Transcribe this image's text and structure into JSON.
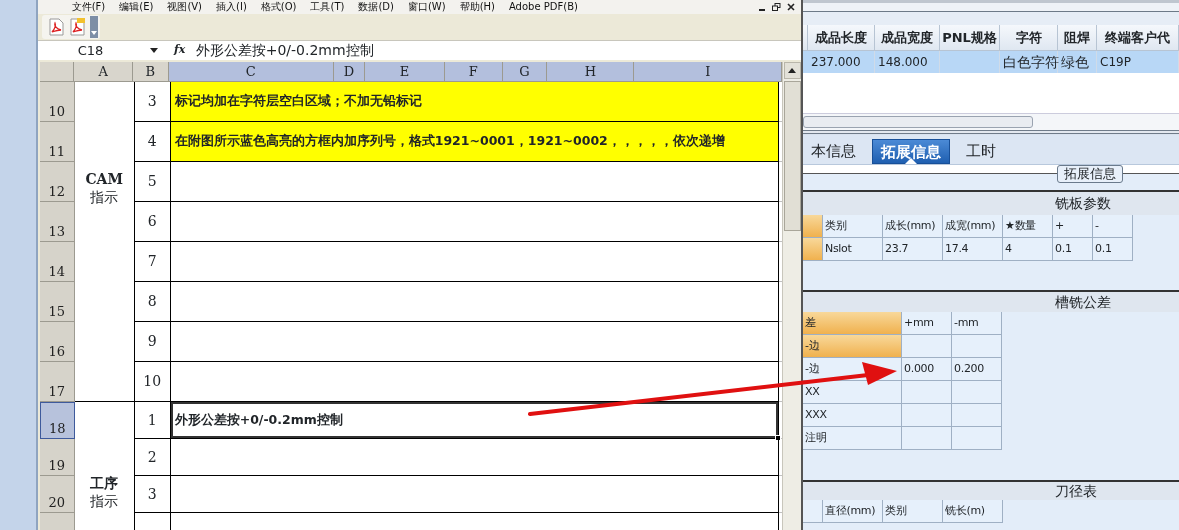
{
  "excel": {
    "menu": [
      "文件(F)",
      "编辑(E)",
      "视图(V)",
      "插入(I)",
      "格式(O)",
      "工具(T)",
      "数据(D)",
      "窗口(W)",
      "帮助(H)",
      "Adobe PDF(B)"
    ],
    "name_box": "C18",
    "fx": "fx",
    "formula": "外形公差按+0/-0.2mm控制",
    "columns": [
      {
        "label": "A",
        "selected": false
      },
      {
        "label": "B",
        "selected": false
      },
      {
        "label": "C",
        "selected": true
      },
      {
        "label": "D",
        "selected": true
      },
      {
        "label": "E",
        "selected": true
      },
      {
        "label": "F",
        "selected": true
      },
      {
        "label": "G",
        "selected": true
      },
      {
        "label": "H",
        "selected": true
      },
      {
        "label": "I",
        "selected": true
      }
    ],
    "groups": [
      {
        "label": [
          "CAM",
          "指示"
        ],
        "rows": [
          {
            "number": "10",
            "item": "3",
            "text": "标记均加在字符层空白区域；不加无铅标记",
            "highlighted": true,
            "selected": false
          },
          {
            "number": "11",
            "item": "4",
            "text": "在附图所示蓝色高亮的方框内加序列号，格式1921~0001，1921~0002，，，，，依次递增",
            "highlighted": true,
            "selected": false
          },
          {
            "number": "12",
            "item": "5",
            "highlighted": false,
            "selected": false
          },
          {
            "number": "13",
            "item": "6",
            "highlighted": false,
            "selected": false
          },
          {
            "number": "14",
            "item": "7",
            "highlighted": false,
            "selected": false
          },
          {
            "number": "15",
            "item": "8",
            "highlighted": false,
            "selected": false
          },
          {
            "number": "16",
            "item": "9",
            "highlighted": false,
            "selected": false
          },
          {
            "number": "17",
            "item": "10",
            "highlighted": false,
            "selected": false
          }
        ]
      },
      {
        "label": [
          "工序",
          "指示"
        ],
        "rows": [
          {
            "number": "18",
            "item": "1",
            "text": "外形公差按+0/-0.2mm控制",
            "highlighted": false,
            "selected": true
          },
          {
            "number": "19",
            "item": "2",
            "highlighted": false,
            "selected": false
          },
          {
            "number": "20",
            "item": "3",
            "highlighted": false,
            "selected": false
          },
          {
            "highlighted": false,
            "selected": false
          }
        ]
      }
    ]
  },
  "detail": {
    "table": {
      "columns": [
        "成品长度",
        "成品宽度",
        "PNL规格",
        "字符",
        "阻焊",
        "终端客户代"
      ],
      "rows": [
        {
          "selected": true,
          "cells": [
            "237.000",
            "148.000",
            null,
            "白色字符",
            "绿色",
            "C19P"
          ]
        }
      ]
    },
    "tabs": [
      {
        "label": "本信息",
        "selected": false
      },
      {
        "label": "拓展信息",
        "selected": true
      },
      {
        "label": "工时",
        "selected": false
      }
    ],
    "group_title": "拓展信息",
    "sections": [
      {
        "title": "铣板参数",
        "columns": [
          "类别",
          "成长(mm)",
          "成宽(mm)",
          "★数量",
          "+",
          "-"
        ],
        "rows": [
          {
            "selected": true,
            "cells": [
              "Nslot",
              "23.7",
              "17.4",
              "4",
              "0.1",
              "0.1"
            ]
          }
        ]
      },
      {
        "title": "槽铣公差",
        "columns": [
          "差",
          "+mm",
          "-mm"
        ],
        "rows": [
          {
            "selected": true,
            "cells": [
              "-边",
              null,
              null
            ]
          },
          {
            "selected": false,
            "cells": [
              "-边",
              "0.000",
              "0.200"
            ]
          },
          {
            "selected": false,
            "cells": [
              "XX",
              null,
              null
            ]
          },
          {
            "selected": false,
            "cells": [
              "XXX",
              null,
              null
            ]
          },
          {
            "selected": false,
            "cells": [
              "注明",
              null,
              null
            ]
          }
        ]
      },
      {
        "title": "刀径表",
        "columns": [
          "直径(mm)",
          "类别",
          "铣长(m)"
        ]
      }
    ]
  }
}
